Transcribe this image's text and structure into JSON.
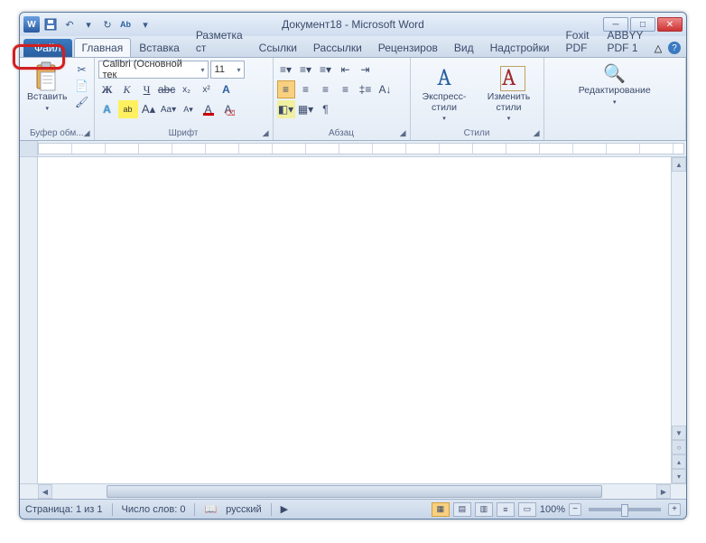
{
  "title": "Документ18  -  Microsoft Word",
  "qat": {
    "word": "W",
    "save": "💾",
    "undo": "↶",
    "redo": "↻",
    "find": "🔍"
  },
  "tabs": {
    "file": "Файл",
    "items": [
      "Главная",
      "Вставка",
      "Разметка ст",
      "Ссылки",
      "Рассылки",
      "Рецензиров",
      "Вид",
      "Надстройки",
      "Foxit PDF",
      "ABBYY PDF 1"
    ],
    "active": 0
  },
  "ribbon": {
    "clipboard": {
      "paste": "Вставить",
      "label": "Буфер обм..."
    },
    "font": {
      "name": "Calibri (Основной тек",
      "size": "11",
      "bold": "Ж",
      "italic": "К",
      "under": "Ч",
      "strike": "abc",
      "sub": "x₂",
      "sup": "x²",
      "grow": "A",
      "shrink": "A",
      "case": "Aa",
      "clear": "A",
      "effects": "A",
      "color": "A",
      "label": "Шрифт"
    },
    "paragraph": {
      "label": "Абзац"
    },
    "styles": {
      "quick": "Экспресс-стили",
      "change": "Изменить стили",
      "label": "Стили"
    },
    "editing": {
      "label": "Редактирование"
    }
  },
  "status": {
    "page": "Страница: 1 из 1",
    "words": "Число слов: 0",
    "lang": "русский",
    "zoom": "100%"
  },
  "winbtns": {
    "min": "─",
    "max": "□",
    "close": "✕"
  }
}
